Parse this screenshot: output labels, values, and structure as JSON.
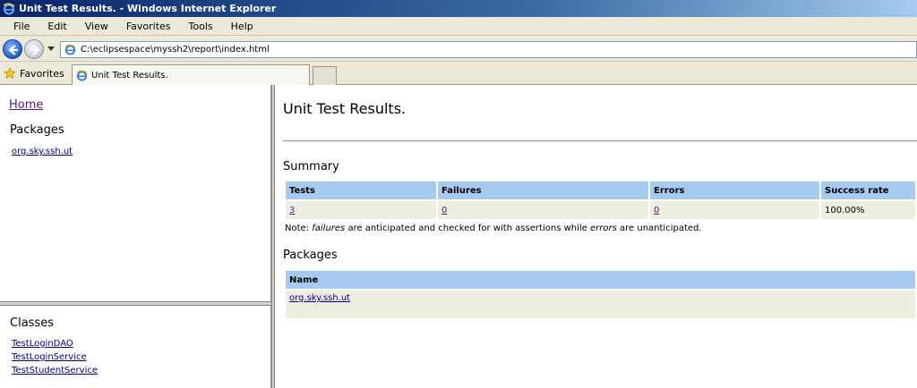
{
  "window": {
    "title": "Unit Test Results. - Windows Internet Explorer"
  },
  "menu": {
    "items": [
      "File",
      "Edit",
      "View",
      "Favorites",
      "Tools",
      "Help"
    ]
  },
  "address": {
    "url": "C:\\eclipsespace\\myssh2\\report\\index.html"
  },
  "favorites": {
    "label": "Favorites"
  },
  "tab": {
    "title": "Unit Test Results."
  },
  "left": {
    "home": "Home",
    "packages_heading": "Packages",
    "packages": [
      "org.sky.ssh.ut"
    ],
    "classes_heading": "Classes",
    "classes": [
      "TestLoginDAO",
      "TestLoginService",
      "TestStudentService"
    ]
  },
  "main": {
    "title": "Unit Test Results.",
    "summary_heading": "Summary",
    "summary_headers": [
      "Tests",
      "Failures",
      "Errors",
      "Success rate"
    ],
    "summary_values": [
      "3",
      "0",
      "0",
      "100.00%"
    ],
    "note": {
      "prefix": "Note: ",
      "failures": "failures",
      "middle": " are anticipated and checked for with assertions while ",
      "errors": "errors",
      "suffix": " are unanticipated."
    },
    "packages_heading": "Packages",
    "packages_header": "Name",
    "packages": [
      "org.sky.ssh.ut"
    ]
  },
  "colors": {
    "table_header": "#a6caf0",
    "table_cell": "#eeeee0",
    "titlebar": "#0a246a"
  },
  "icons": [
    "ie-icon",
    "back-arrow-icon",
    "forward-arrow-icon",
    "star-icon"
  ]
}
